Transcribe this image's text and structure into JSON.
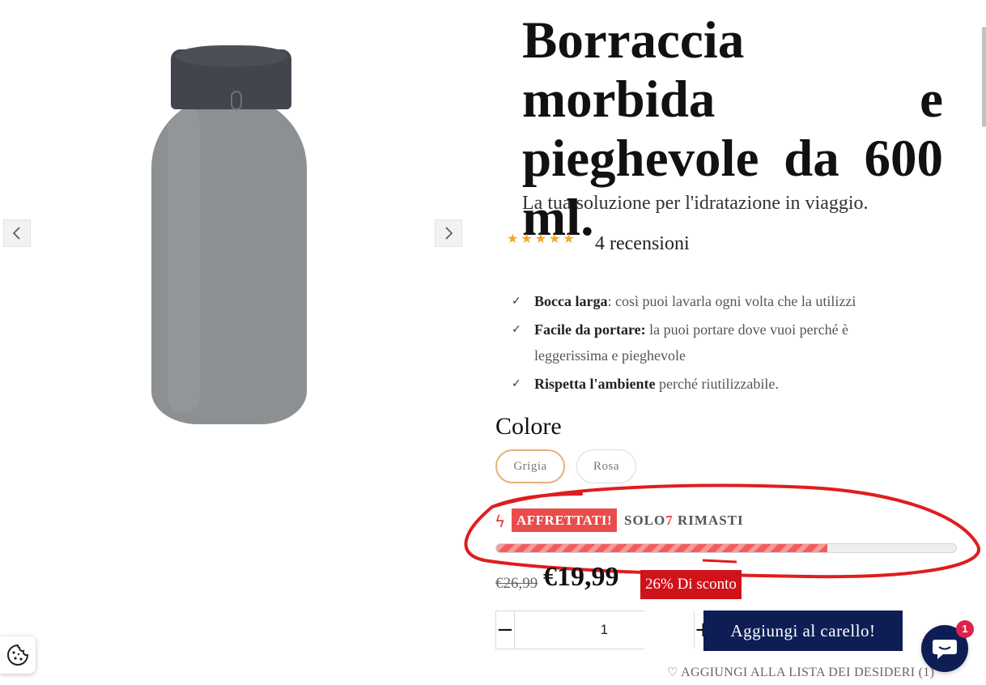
{
  "gallery": {
    "image_alt": "Borraccia grigia",
    "prev_icon": "chevron-left-icon",
    "next_icon": "chevron-right-icon"
  },
  "product": {
    "title": "Borraccia morbida e pieghevole da 600 ml.",
    "subtitle": "La tua soluzione per l'idratazione in viaggio.",
    "rating": {
      "stars": "★★★★★",
      "value": 5,
      "reviews_label": "4 recensioni"
    },
    "features": [
      {
        "bold": "Bocca larga",
        "text": ": così puoi lavarla ogni volta che la utilizzi"
      },
      {
        "bold": "Facile da portare:",
        "text": " la puoi portare dove vuoi perché è leggerissima e pieghevole"
      },
      {
        "bold": "Rispetta l'ambiente",
        "text": " perché riutilizzabile."
      }
    ]
  },
  "variant": {
    "label": "Colore",
    "options": [
      "Grigia",
      "Rosa"
    ],
    "selected": "Grigia",
    "selected_color": "#e8b07a"
  },
  "urgency": {
    "badge": "AFFRETTATI!",
    "stock_prefix": "SOLO",
    "stock_count": "7",
    "stock_suffix": "RIMASTI",
    "progress_fraction": 0.72,
    "accent_color": "#ea4b4b"
  },
  "price": {
    "old": "€26,99",
    "current": "€19,99",
    "discount": "26% Di sconto"
  },
  "cart": {
    "quantity": "1",
    "minus": "−",
    "plus": "+",
    "add_label": "Aggiungi al carello!",
    "button_color": "#0e1e55"
  },
  "wishlist": {
    "label": "AGGIUNGI ALLA LISTA DEI DESIDERI (1)"
  },
  "widgets": {
    "chat_badge": "1",
    "cookie_icon": "cookie-icon",
    "chat_icon": "chat-icon"
  }
}
